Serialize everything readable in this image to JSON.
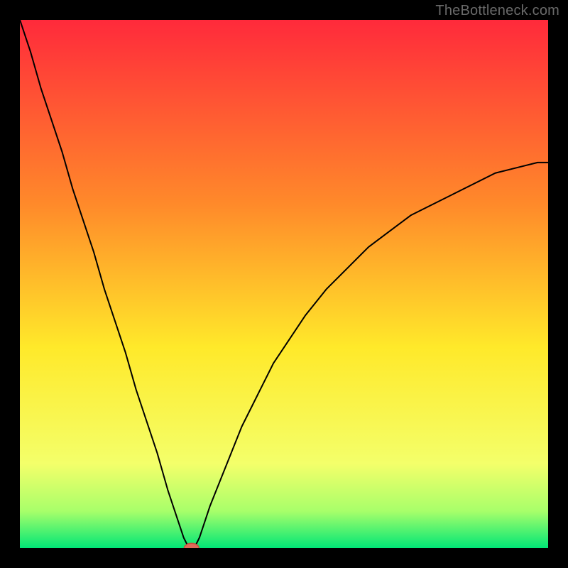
{
  "watermark": "TheBottleneck.com",
  "colors": {
    "frame": "#000000",
    "gradient_top": "#ff2a3b",
    "gradient_mid_upper": "#ff8a2a",
    "gradient_mid": "#ffe92a",
    "gradient_mid_lower": "#f4ff6a",
    "gradient_green_light": "#a8ff6a",
    "gradient_green": "#00e676",
    "curve": "#000000",
    "marker_fill": "#e06a5a",
    "marker_stroke": "#c94f3f"
  },
  "chart_data": {
    "type": "line",
    "title": "",
    "xlabel": "",
    "ylabel": "",
    "xlim": [
      0,
      100
    ],
    "ylim": [
      0,
      100
    ],
    "series": [
      {
        "name": "bottleneck-curve",
        "x": [
          0,
          2,
          4,
          6,
          8,
          10,
          12,
          14,
          16,
          18,
          20,
          22,
          24,
          26,
          28,
          30,
          31,
          32,
          33,
          34,
          35,
          36,
          38,
          40,
          42,
          44,
          46,
          48,
          50,
          54,
          58,
          62,
          66,
          70,
          74,
          78,
          82,
          86,
          90,
          94,
          98,
          100
        ],
        "y": [
          100,
          94,
          87,
          81,
          75,
          68,
          62,
          56,
          49,
          43,
          37,
          30,
          24,
          18,
          11,
          5,
          2,
          0,
          0,
          2,
          5,
          8,
          13,
          18,
          23,
          27,
          31,
          35,
          38,
          44,
          49,
          53,
          57,
          60,
          63,
          65,
          67,
          69,
          71,
          72,
          73,
          73
        ]
      }
    ],
    "marker": {
      "x": 32.5,
      "y": 0
    },
    "grid": false,
    "legend": false
  }
}
